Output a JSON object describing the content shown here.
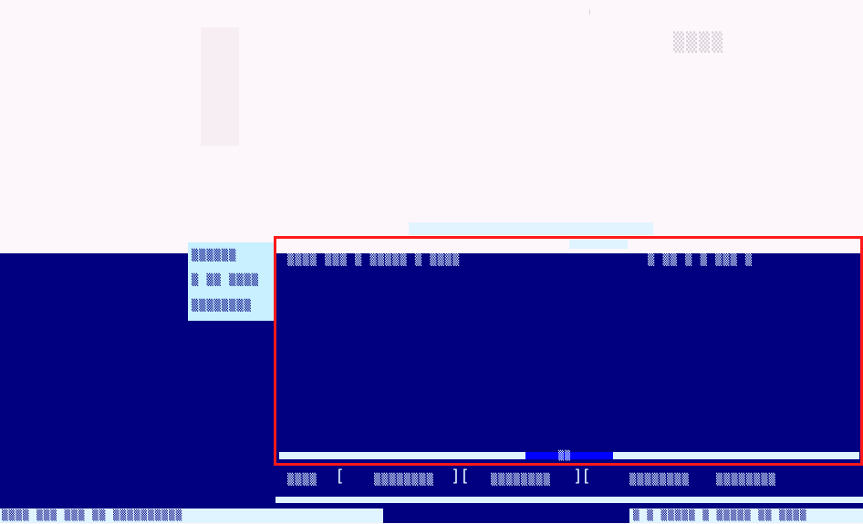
{
  "top": {
    "title_glyph": "ⅰ",
    "corner_text": "▒▒▒▒"
  },
  "left_panel": {
    "line1": "▒▒▒▒▒▒",
    "line2": "▒ ▒▒ ▒▒▒▒",
    "line3": "▒▒▒▒▒▒▒▒"
  },
  "main": {
    "header_left": "▒▒▒▒  ▒▒▒  ▒  ▒▒▒▒▒ ▒ ▒▒▒▒",
    "header_right": "▒  ▒▒  ▒  ▒  ▒▒▒  ▒",
    "status_label": "▒▒",
    "footer_labels": [
      "▒▒▒▒",
      "▒▒▒▒▒▒▒▒",
      "▒▒▒▒▒▒▒▒",
      "▒▒▒▒▒▒▒▒",
      "▒▒▒▒▒▒▒▒"
    ],
    "bottom_bar": "▒▒▒▒ ▒▒▒▒▒  ▒▒  ▒▒▒▒▒▒▒▒▒▒"
  },
  "footer": {
    "left": "▒▒▒▒ ▒▒▒ ▒▒▒  ▒▒  ▒▒▒▒▒▒▒▒▒▒",
    "right": "▒ ▒ ▒▒▒▒▒  ▒ ▒▒▒▒▒ ▒▒ ▒▒▒▒"
  }
}
